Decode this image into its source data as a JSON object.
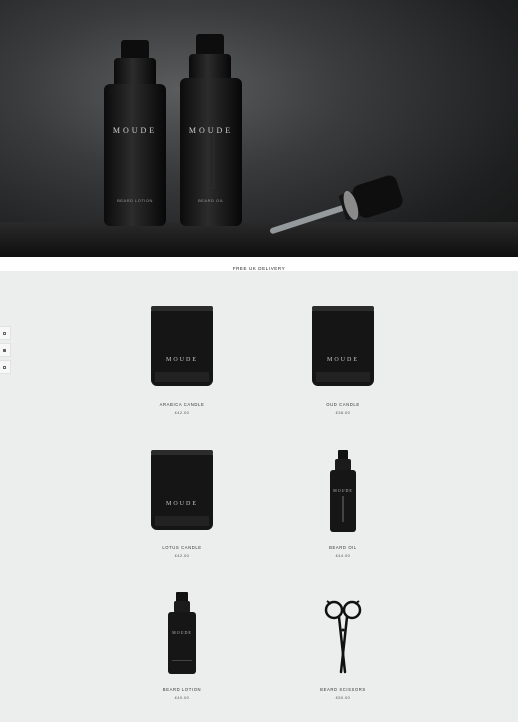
{
  "hero": {
    "brand": "MOUDE",
    "bottle_left_label": "BEARD LOTION",
    "bottle_right_label": "BEARD OIL"
  },
  "banner": {
    "text": "FREE UK DELIVERY"
  },
  "sidebar": {
    "icons": [
      "grid-icon",
      "list-icon",
      "square-icon"
    ]
  },
  "products": [
    {
      "name": "ARABICA CANDLE",
      "price": "£42.00",
      "brand": "MOUDE"
    },
    {
      "name": "OUD CANDLE",
      "price": "£38.00",
      "brand": "MOUDE"
    },
    {
      "name": "LOTUS CANDLE",
      "price": "£42.00",
      "brand": "MOUDE"
    },
    {
      "name": "BEARD OIL",
      "price": "£44.00",
      "brand": "MOUDE"
    },
    {
      "name": "BEARD LOTION",
      "price": "£40.00",
      "brand": "MOUDE"
    },
    {
      "name": "BEARD SCISSORS",
      "price": "£50.00"
    }
  ]
}
